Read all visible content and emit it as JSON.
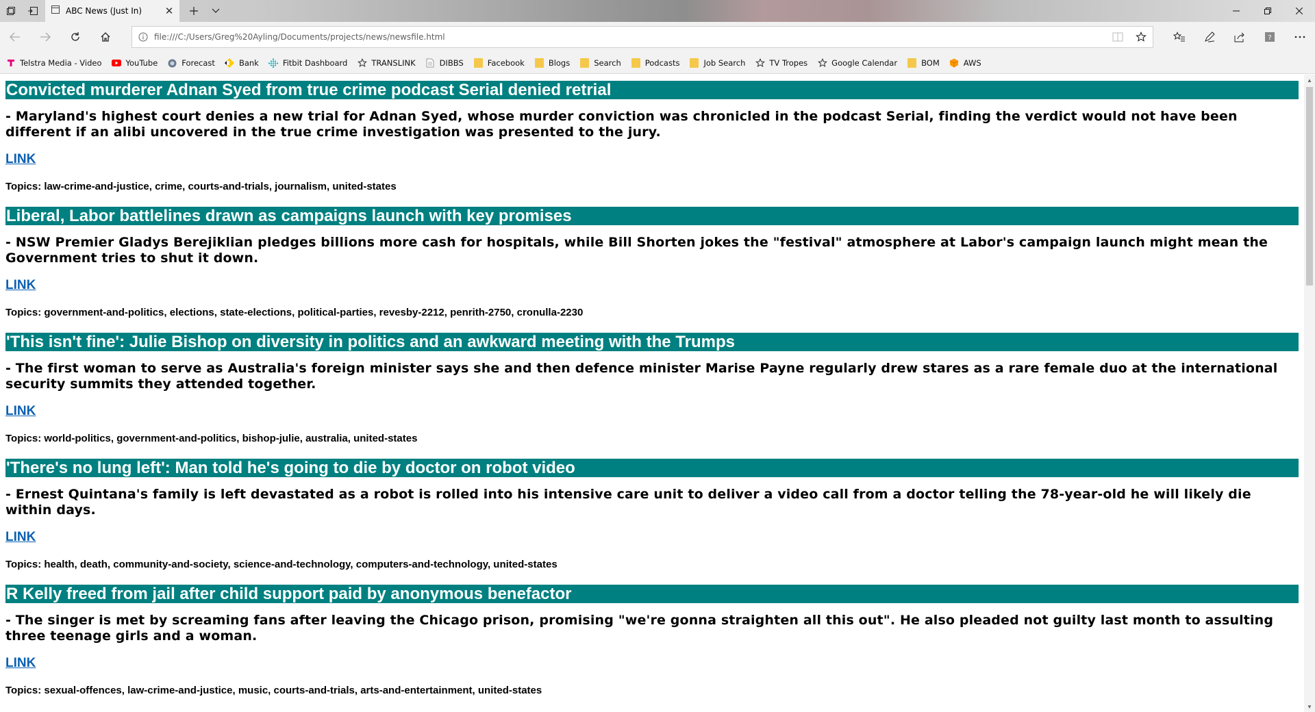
{
  "browser": {
    "tab": {
      "title": "ABC News (Just In)"
    },
    "address": {
      "url": "file:///C:/Users/Greg%20Ayling/Documents/projects/news/newsfile.html"
    },
    "favorites": [
      {
        "label": "Telstra Media - Video",
        "icon": "telstra-icon",
        "color": "#e6007e"
      },
      {
        "label": "YouTube",
        "icon": "youtube-icon",
        "color": "#ff0000"
      },
      {
        "label": "Forecast",
        "icon": "globe-icon",
        "color": "#6b7a8f"
      },
      {
        "label": "Bank",
        "icon": "bank-icon",
        "color": "#ffcc00"
      },
      {
        "label": "Fitbit Dashboard",
        "icon": "fitbit-icon",
        "color": "#00b0b9"
      },
      {
        "label": "TRANSLINK",
        "icon": "star-icon",
        "color": "#333333"
      },
      {
        "label": "DIBBS",
        "icon": "page-icon",
        "color": "#999999"
      },
      {
        "label": "Facebook",
        "icon": "folder-icon",
        "color": "#f5c84c"
      },
      {
        "label": "Blogs",
        "icon": "folder-icon",
        "color": "#f5c84c"
      },
      {
        "label": "Search",
        "icon": "folder-icon",
        "color": "#f5c84c"
      },
      {
        "label": "Podcasts",
        "icon": "folder-icon",
        "color": "#f5c84c"
      },
      {
        "label": "Job Search",
        "icon": "folder-icon",
        "color": "#f5c84c"
      },
      {
        "label": "TV Tropes",
        "icon": "star-icon",
        "color": "#333333"
      },
      {
        "label": "Google Calendar",
        "icon": "star-icon",
        "color": "#333333"
      },
      {
        "label": "BOM",
        "icon": "folder-icon",
        "color": "#f5c84c"
      },
      {
        "label": "AWS",
        "icon": "aws-icon",
        "color": "#ff9900"
      }
    ]
  },
  "page": {
    "colors": {
      "header_bg": "#008080",
      "link": "#0b5fb3"
    },
    "articles": [
      {
        "title": "Convicted murderer Adnan Syed from true crime podcast Serial denied retrial",
        "summary": "- Maryland's highest court denies a new trial for Adnan Syed, whose murder conviction was chronicled in the podcast Serial, finding the verdict would not have been different if an alibi uncovered in the true crime investigation was presented to the jury.",
        "link": "LINK",
        "topics": "Topics: law-crime-and-justice, crime, courts-and-trials, journalism, united-states"
      },
      {
        "title": "Liberal, Labor battlelines drawn as campaigns launch with key promises",
        "summary": "- NSW Premier Gladys Berejiklian pledges billions more cash for hospitals, while Bill Shorten jokes the \"festival\" atmosphere at Labor's campaign launch might mean the Government tries to shut it down.",
        "link": "LINK",
        "topics": "Topics: government-and-politics, elections, state-elections, political-parties, revesby-2212, penrith-2750, cronulla-2230"
      },
      {
        "title": "'This isn't fine': Julie Bishop on diversity in politics and an awkward meeting with the Trumps",
        "summary": "- The first woman to serve as Australia's foreign minister says she and then defence minister Marise Payne regularly drew stares as a rare female duo at the international security summits they attended together.",
        "link": "LINK",
        "topics": "Topics: world-politics, government-and-politics, bishop-julie, australia, united-states"
      },
      {
        "title": "'There's no lung left': Man told he's going to die by doctor on robot video",
        "summary": "- Ernest Quintana's family is left devastated as a robot is rolled into his intensive care unit to deliver a video call from a doctor telling the 78-year-old he will likely die within days.",
        "link": "LINK",
        "topics": "Topics: health, death, community-and-society, science-and-technology, computers-and-technology, united-states"
      },
      {
        "title": "R Kelly freed from jail after child support paid by anonymous benefactor",
        "summary": "- The singer is met by screaming fans after leaving the Chicago prison, promising \"we're gonna straighten all this out\". He also pleaded not guilty last month to assulting three teenage girls and a woman.",
        "link": "LINK",
        "topics": "Topics: sexual-offences, law-crime-and-justice, music, courts-and-trials, arts-and-entertainment, united-states"
      }
    ]
  }
}
